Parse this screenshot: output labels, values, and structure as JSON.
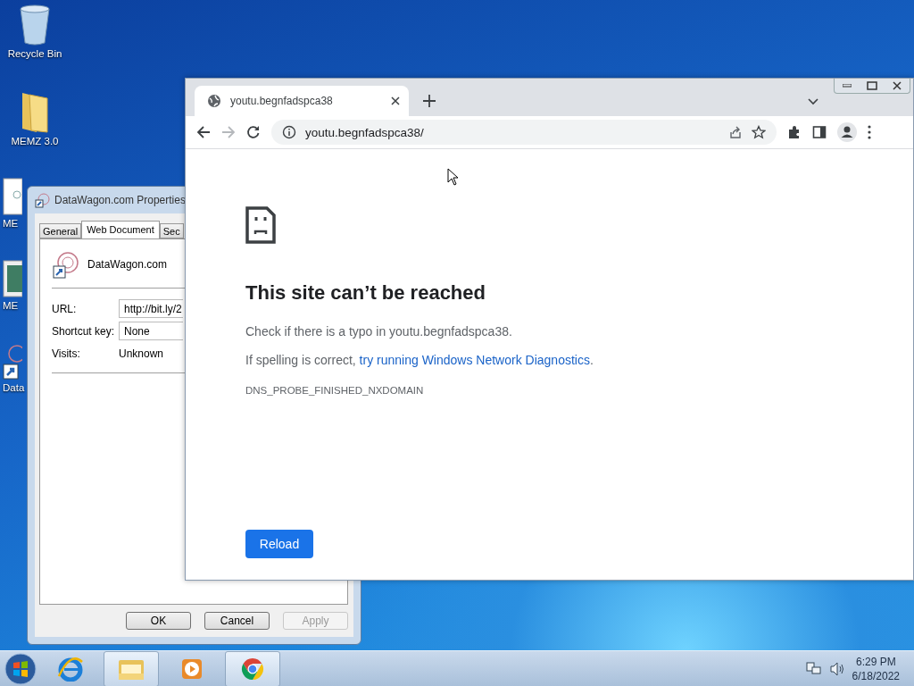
{
  "desktop": {
    "icons": [
      {
        "label": "Recycle Bin",
        "kind": "bin"
      },
      {
        "label": "MEMZ 3.0",
        "kind": "folder"
      },
      {
        "label": "ME",
        "kind": "document"
      },
      {
        "label": "ME",
        "kind": "image"
      },
      {
        "label": "Data",
        "kind": "shortcut"
      }
    ]
  },
  "properties_dialog": {
    "title": "DataWagon.com Properties",
    "tabs": [
      {
        "label": "General",
        "selected": false
      },
      {
        "label": "Web Document",
        "selected": true
      },
      {
        "label": "Sec",
        "selected": false
      }
    ],
    "name": "DataWagon.com",
    "fields": [
      {
        "kind": "input",
        "label": "URL:",
        "value": "http://bit.ly/2"
      },
      {
        "kind": "input",
        "label": "Shortcut key:",
        "value": "None"
      },
      {
        "kind": "text",
        "label": "Visits:",
        "value": "Unknown"
      }
    ],
    "buttons": [
      {
        "label": "OK",
        "disabled": false
      },
      {
        "label": "Cancel",
        "disabled": false
      },
      {
        "label": "Apply",
        "disabled": true
      }
    ]
  },
  "browser": {
    "tab_title": "youtu.begnfadspca38",
    "address": "youtu.begnfadspca38/",
    "forward_disabled": true,
    "error": {
      "title": "This site can’t be reached",
      "hint": "Check if there is a typo in youtu.begnfadspca38.",
      "diagnose_before": "If spelling is correct, ",
      "diagnose_link": "try running Windows Network Diagnostics",
      "diagnose_after": ".",
      "code": "DNS_PROBE_FINISHED_NXDOMAIN",
      "button": "Reload"
    }
  },
  "taskbar": {
    "apps": [
      {
        "kind": "ie",
        "open": false
      },
      {
        "kind": "explorer",
        "open": true
      },
      {
        "kind": "media",
        "open": false
      },
      {
        "kind": "chrome",
        "open": true
      }
    ],
    "time": "6:29 PM",
    "date": "6/18/2022"
  }
}
